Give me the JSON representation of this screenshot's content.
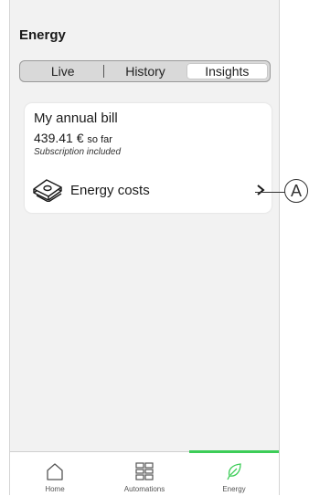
{
  "header": {
    "title": "Energy"
  },
  "segments": [
    {
      "label": "Live",
      "active": false
    },
    {
      "label": "History",
      "active": false
    },
    {
      "label": "Insights",
      "active": true
    }
  ],
  "bill_card": {
    "title": "My annual bill",
    "amount": "439.41 €",
    "amount_suffix": "so far",
    "subscription_note": "Subscription included",
    "costs_row": {
      "label": "Energy costs",
      "icon": "money-stack-icon",
      "chevron_icon": "chevron-right-icon"
    }
  },
  "callout": {
    "label": "A"
  },
  "tabbar": {
    "accent_color": "#3dcd58",
    "tabs": [
      {
        "label": "Home",
        "icon": "house-icon",
        "active": false
      },
      {
        "label": "Automations",
        "icon": "grid-icon",
        "active": false
      },
      {
        "label": "Energy",
        "icon": "leaf-icon",
        "active": true
      }
    ]
  }
}
